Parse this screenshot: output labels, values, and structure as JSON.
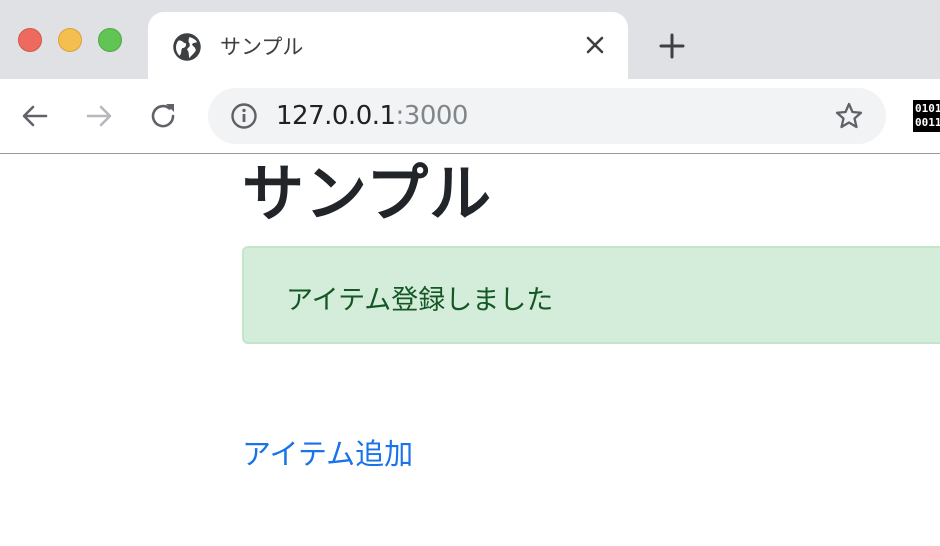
{
  "browser": {
    "tab": {
      "title": "サンプル",
      "icon": "globe-icon"
    },
    "address_bar": {
      "host": "127.0.0.1",
      "port": ":3000"
    },
    "colors": {
      "tabstrip": "#dfe1e5",
      "omnibox": "#f1f3f4",
      "link": "#1a73e8",
      "alert_bg": "#d4edda",
      "alert_text": "#155724"
    }
  },
  "extension": {
    "text": "0101\n0011",
    "icon": "binary-extension-icon"
  },
  "page": {
    "title": "サンプル",
    "alert": "アイテム登録しました",
    "add_link": "アイテム追加"
  }
}
